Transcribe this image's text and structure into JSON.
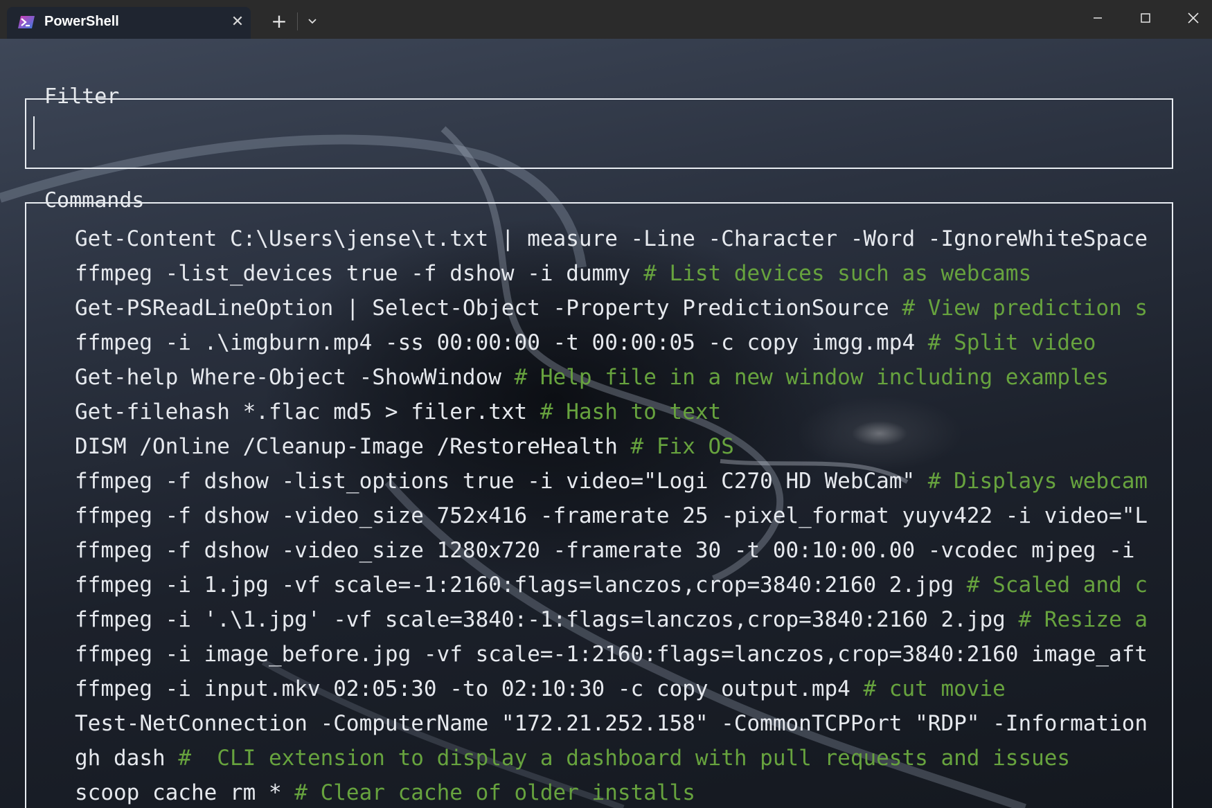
{
  "titlebar": {
    "tab_title": "PowerShell",
    "tab_icon": "powershell-icon",
    "close_tab_icon": "close-icon",
    "new_tab_icon": "plus-icon",
    "dropdown_icon": "chevron-down-icon",
    "minimize_icon": "minimize-icon",
    "maximize_icon": "maximize-icon",
    "close_window_icon": "close-icon"
  },
  "filter": {
    "title": "Filter",
    "value": ""
  },
  "commands": {
    "title": "Commands",
    "items": [
      {
        "cmd": "Get-Content C:\\Users\\jense\\t.txt | measure -Line -Character -Word -IgnoreWhiteSpace",
        "comment": ""
      },
      {
        "cmd": "ffmpeg -list_devices true -f dshow -i dummy ",
        "comment": "# List devices such as webcams"
      },
      {
        "cmd": "Get-PSReadLineOption | Select-Object -Property PredictionSource ",
        "comment": "# View prediction s"
      },
      {
        "cmd": "ffmpeg -i .\\imgburn.mp4 -ss 00:00:00 -t 00:00:05 -c copy imgg.mp4 ",
        "comment": "# Split video"
      },
      {
        "cmd": "Get-help Where-Object -ShowWindow ",
        "comment": "# Help file in a new window including examples"
      },
      {
        "cmd": "Get-filehash *.flac md5 > filer.txt ",
        "comment": "# Hash to text"
      },
      {
        "cmd": "DISM /Online /Cleanup-Image /RestoreHealth ",
        "comment": "# Fix OS"
      },
      {
        "cmd": "ffmpeg -f dshow -list_options true -i video=\"Logi C270 HD WebCam\" ",
        "comment": "# Displays webcam"
      },
      {
        "cmd": "ffmpeg -f dshow -video_size 752x416 -framerate 25 -pixel_format yuyv422 -i video=\"L",
        "comment": ""
      },
      {
        "cmd": "ffmpeg -f dshow -video_size 1280x720 -framerate 30 -t 00:10:00.00 -vcodec mjpeg -i ",
        "comment": ""
      },
      {
        "cmd": "ffmpeg -i 1.jpg -vf scale=-1:2160:flags=lanczos,crop=3840:2160 2.jpg ",
        "comment": "# Scaled and c"
      },
      {
        "cmd": "ffmpeg -i '.\\1.jpg' -vf scale=3840:-1:flags=lanczos,crop=3840:2160 2.jpg ",
        "comment": "# Resize a"
      },
      {
        "cmd": "ffmpeg -i image_before.jpg -vf scale=-1:2160:flags=lanczos,crop=3840:2160 image_aft",
        "comment": ""
      },
      {
        "cmd": "ffmpeg -i input.mkv 02:05:30 -to 02:10:30 -c copy output.mp4 ",
        "comment": "# cut movie"
      },
      {
        "cmd": "Test-NetConnection -ComputerName \"172.21.252.158\" -CommonTCPPort \"RDP\" -Information",
        "comment": ""
      },
      {
        "cmd": "gh dash ",
        "comment": "#  CLI extension to display a dashboard with pull requests and issues"
      },
      {
        "cmd": "scoop cache rm * ",
        "comment": "# Clear cache of older installs"
      }
    ]
  },
  "colors": {
    "text": "#e6e9ee",
    "comment": "#67a33e",
    "border": "#e9edf2"
  }
}
